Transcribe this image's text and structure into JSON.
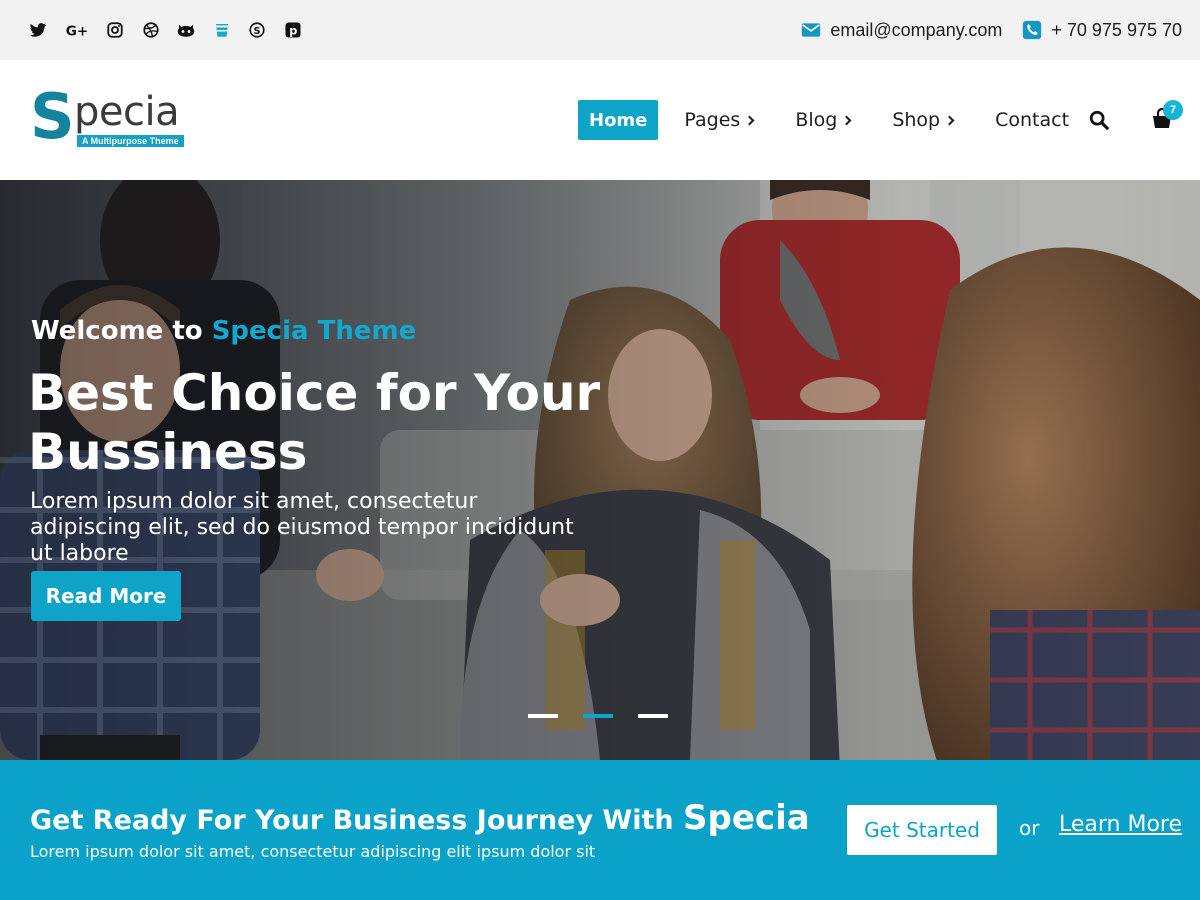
{
  "topbar": {
    "social_icons": [
      "twitter-icon",
      "google-plus-icon",
      "instagram-icon",
      "dribbble-icon",
      "github-icon",
      "bucket-icon",
      "skype-icon",
      "pinterest-icon"
    ],
    "email": "email@company.com",
    "phone": "+ 70 975 975 70"
  },
  "header": {
    "logo_initial": "S",
    "logo_rest": "pecia",
    "logo_tagline": "A Multipurpose Theme",
    "nav": [
      {
        "label": "Home",
        "active": true,
        "has_submenu": false
      },
      {
        "label": "Pages",
        "active": false,
        "has_submenu": true
      },
      {
        "label": "Blog",
        "active": false,
        "has_submenu": true
      },
      {
        "label": "Shop",
        "active": false,
        "has_submenu": true
      },
      {
        "label": "Contact",
        "active": false,
        "has_submenu": false
      }
    ],
    "cart_count": "7"
  },
  "hero": {
    "welcome_prefix": "Welcome to ",
    "welcome_highlight": "Specia Theme",
    "headline": "Best Choice for Your Bussiness",
    "lead": "Lorem ipsum dolor sit amet, consectetur adipiscing elit, sed do eiusmod tempor incididunt ut labore",
    "button": "Read More",
    "slides": 3,
    "active_slide": 2
  },
  "cta": {
    "title_prefix": "Get Ready For Your Business Journey With ",
    "title_brand": "Specia",
    "subtitle": "Lorem ipsum dolor sit amet, consectetur adipiscing elit ipsum dolor sit",
    "primary_button": "Get Started",
    "or_text": "or",
    "secondary_link": "Learn More"
  },
  "colors": {
    "accent": "#0ea4c8",
    "topbar_bg": "#f2f2f2",
    "logo_teal": "#13849e"
  }
}
